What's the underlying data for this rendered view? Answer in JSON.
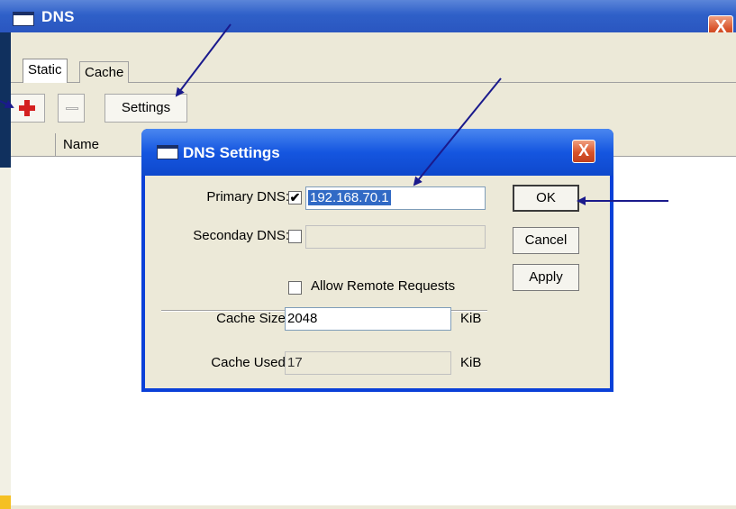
{
  "window": {
    "title": "DNS",
    "close_label": "X"
  },
  "tabs": [
    {
      "label": "Static"
    },
    {
      "label": "Cache"
    }
  ],
  "toolbar": {
    "add_icon": "plus-icon",
    "remove_icon": "minus-icon",
    "settings_label": "Settings"
  },
  "list": {
    "columns": [
      "",
      "Name"
    ]
  },
  "dialog": {
    "title": "DNS Settings",
    "close_label": "X",
    "primary_dns": {
      "label": "Primary DNS:",
      "checked": true,
      "value": "192.168.70.1"
    },
    "secondary_dns": {
      "label": "Seconday DNS:",
      "checked": false,
      "value": ""
    },
    "allow_remote": {
      "label": "Allow Remote Requests",
      "checked": false
    },
    "cache_size": {
      "label": "Cache Size:",
      "value": "2048",
      "unit": "KiB"
    },
    "cache_used": {
      "label": "Cache Used:",
      "value": "17",
      "unit": "KiB"
    },
    "buttons": {
      "ok": "OK",
      "cancel": "Cancel",
      "apply": "Apply"
    }
  },
  "colors": {
    "desktop": "#10305e",
    "titlebar": "#2f60c8",
    "dialog_titlebar": "#1556e0",
    "arrow": "#1a1a8c",
    "add_icon": "#d42020"
  }
}
